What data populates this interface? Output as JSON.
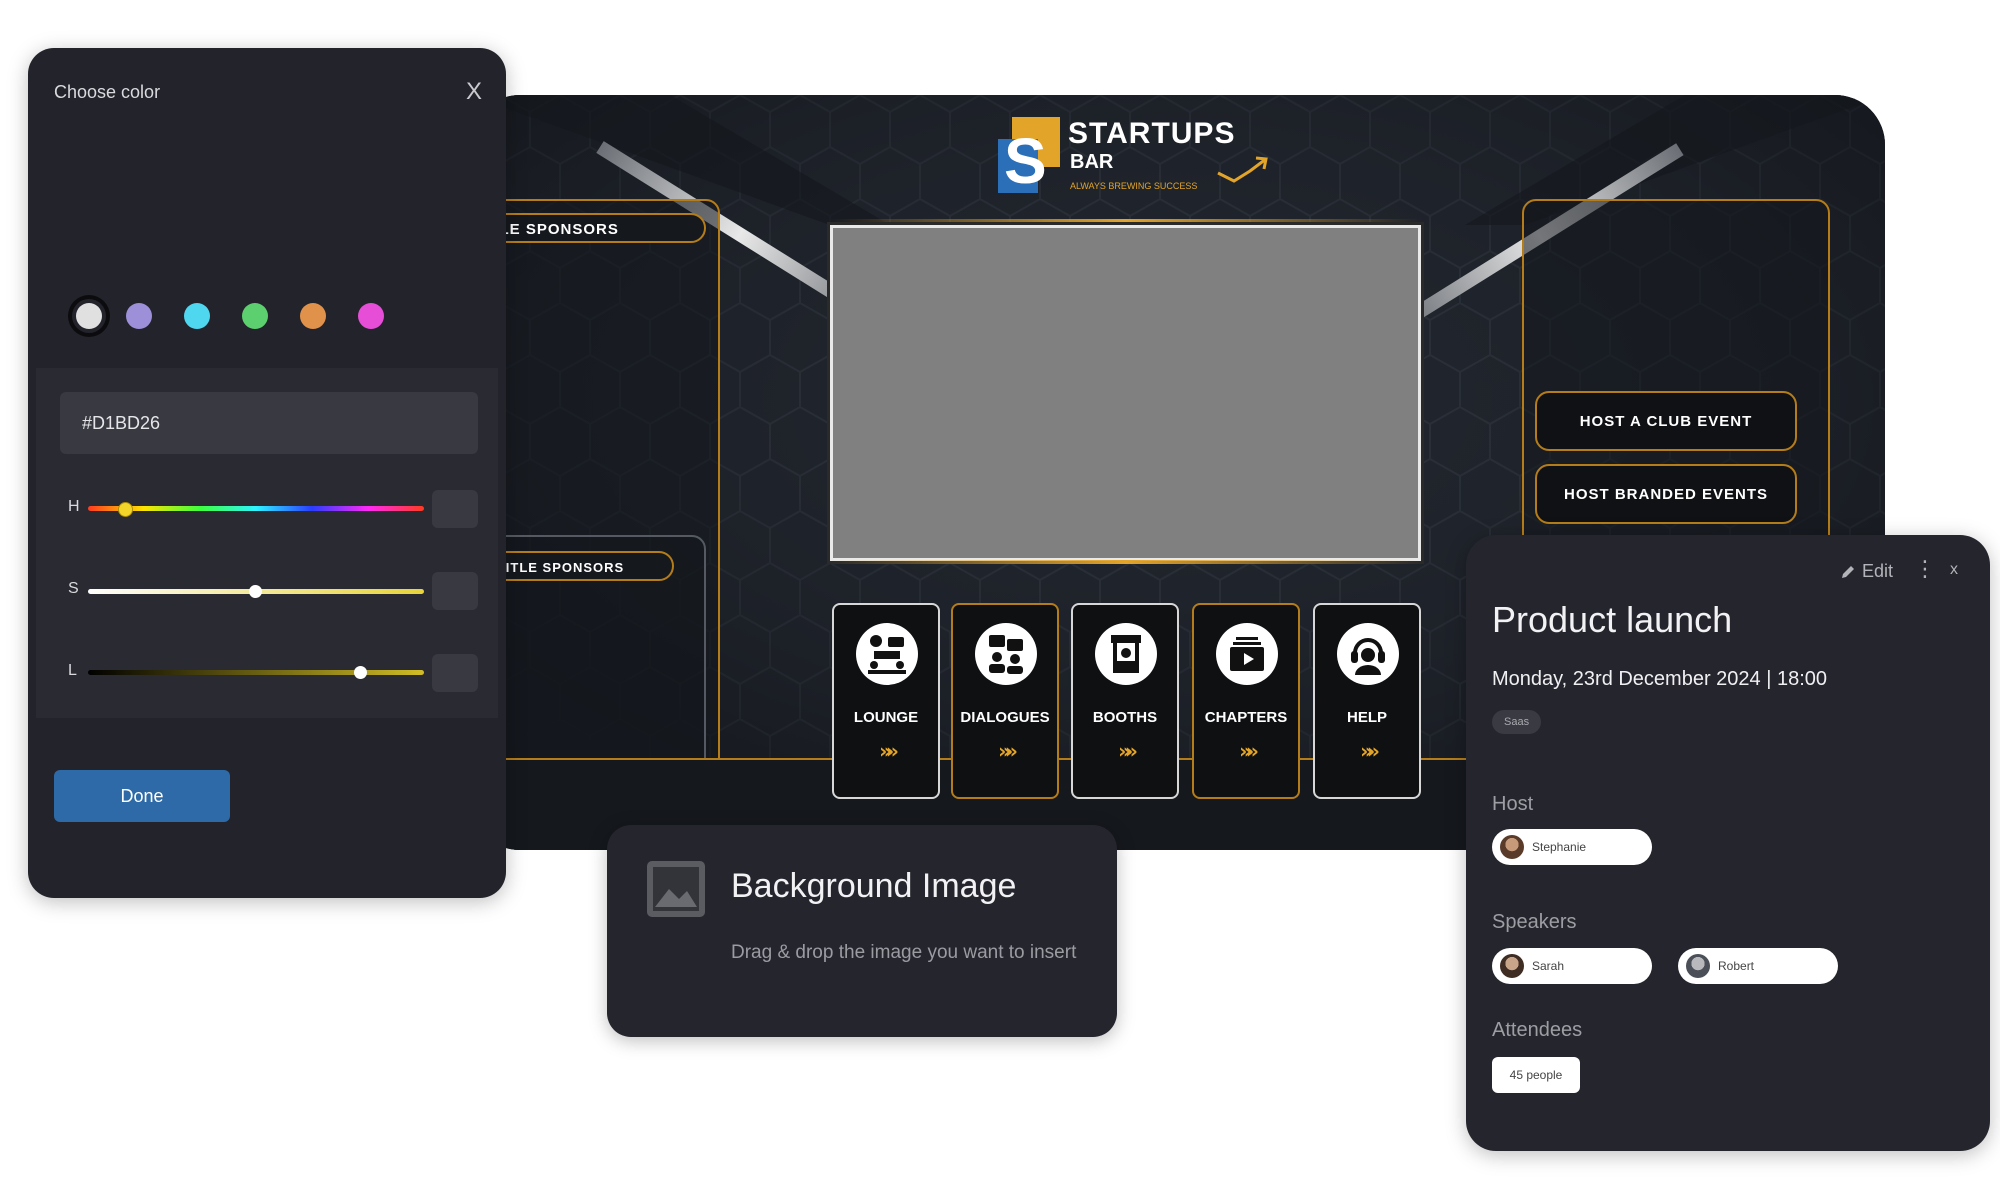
{
  "stage": {
    "logo": {
      "line1": "STARTUPS",
      "line2": "BAR",
      "tagline": "ALWAYS BREWING SUCCESS"
    },
    "title_sponsors": "TITLE SPONSORS",
    "cotitle_sponsors": "CO-TITLE SPONSORS",
    "host_club_event": "HOST A CLUB EVENT",
    "host_branded_events": "HOST BRANDED EVENTS",
    "nav": [
      {
        "label": "LOUNGE",
        "icon": "lounge-icon",
        "arrows": "»»"
      },
      {
        "label": "DIALOGUES",
        "icon": "dialogues-icon",
        "arrows": "»»"
      },
      {
        "label": "BOOTHS",
        "icon": "booths-icon",
        "arrows": "»»"
      },
      {
        "label": "CHAPTERS",
        "icon": "chapters-icon",
        "arrows": "»»"
      },
      {
        "label": "HELP",
        "icon": "help-icon",
        "arrows": "»»"
      }
    ],
    "accent": "#e3a42a"
  },
  "color_picker": {
    "title": "Choose color",
    "close": "X",
    "swatches": [
      "#e0e0e0",
      "#9d8fd8",
      "#4fd7ef",
      "#5ccf6e",
      "#e0914a",
      "#e64ed8"
    ],
    "selected_index": 0,
    "hex_value": "#D1BD26",
    "sliders": [
      {
        "label": "H",
        "value_fraction": 0.11
      },
      {
        "label": "S",
        "value_fraction": 0.5
      },
      {
        "label": "L",
        "value_fraction": 0.82
      }
    ],
    "done_label": "Done"
  },
  "background_image": {
    "title": "Background Image",
    "description": "Drag & drop the image you want to insert"
  },
  "event": {
    "edit_label": "Edit",
    "more": "⋮",
    "close": "x",
    "title": "Product launch",
    "datetime": "Monday, 23rd December 2024 | 18:00",
    "tag": "Saas",
    "host_heading": "Host",
    "host": "Stephanie",
    "speakers_heading": "Speakers",
    "speakers": [
      "Sarah",
      "Robert"
    ],
    "attendees_heading": "Attendees",
    "attendees": "45 people"
  }
}
